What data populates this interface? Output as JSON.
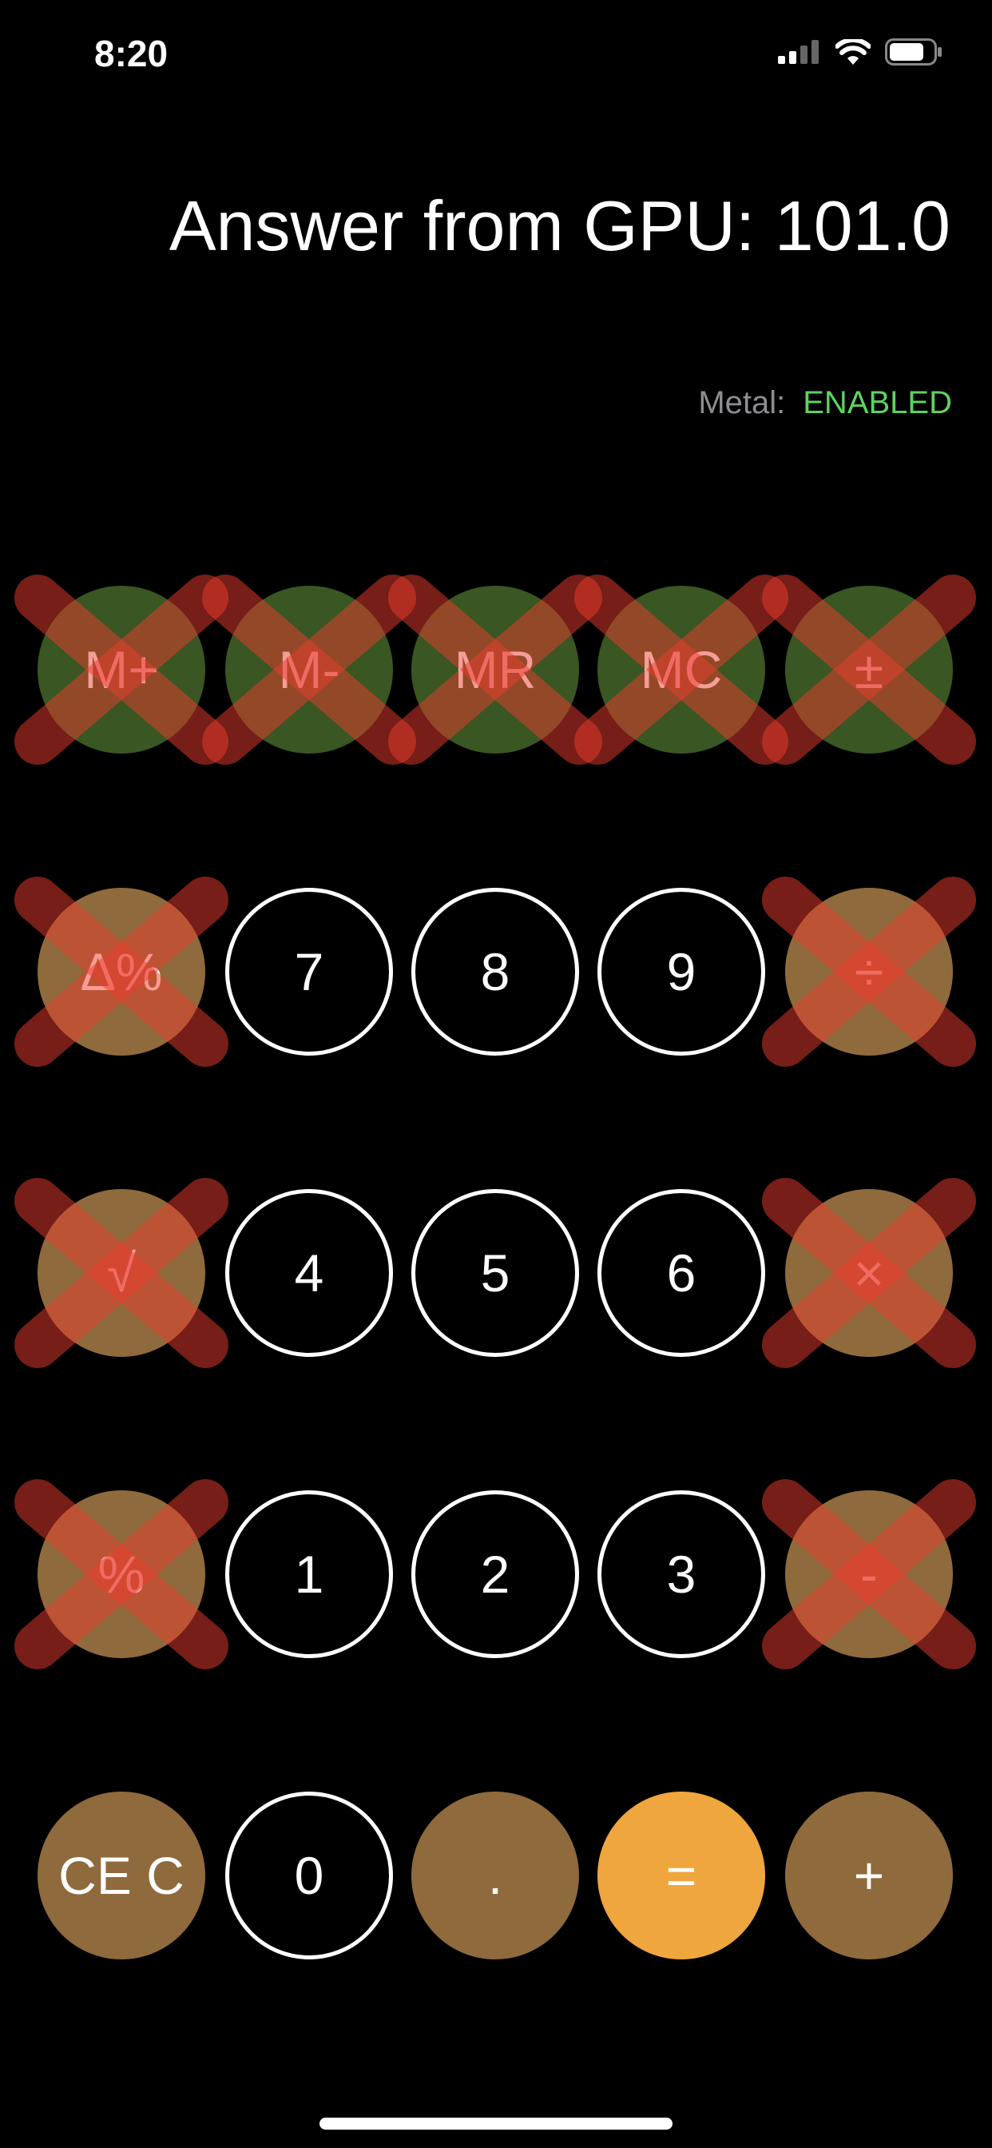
{
  "status_bar": {
    "time": "8:20",
    "icons": [
      "cellular-signal-icon",
      "wifi-icon",
      "battery-icon"
    ]
  },
  "answer_label": "Answer from GPU: 101.0",
  "metal": {
    "label": "Metal:",
    "status": "ENABLED",
    "status_color": "#5ed35e"
  },
  "colors": {
    "green": "#3a5622",
    "brown": "#8f6a3c",
    "orange": "#f0a63e",
    "cross": "rgba(235,60,45,0.5)"
  },
  "keypad": [
    [
      {
        "label": "M+",
        "style": "green",
        "crossed": true
      },
      {
        "label": "M-",
        "style": "green",
        "crossed": true
      },
      {
        "label": "MR",
        "style": "green",
        "crossed": true
      },
      {
        "label": "MC",
        "style": "green",
        "crossed": true
      },
      {
        "label": "±",
        "style": "green",
        "crossed": true
      }
    ],
    [
      {
        "label": "Δ%",
        "style": "brown",
        "crossed": true
      },
      {
        "label": "7",
        "style": "outline",
        "crossed": false
      },
      {
        "label": "8",
        "style": "outline",
        "crossed": false
      },
      {
        "label": "9",
        "style": "outline",
        "crossed": false
      },
      {
        "label": "÷",
        "style": "brown",
        "crossed": true
      }
    ],
    [
      {
        "label": "√",
        "style": "brown",
        "crossed": true
      },
      {
        "label": "4",
        "style": "outline",
        "crossed": false
      },
      {
        "label": "5",
        "style": "outline",
        "crossed": false
      },
      {
        "label": "6",
        "style": "outline",
        "crossed": false
      },
      {
        "label": "×",
        "style": "brown",
        "crossed": true
      }
    ],
    [
      {
        "label": "%",
        "style": "brown",
        "crossed": true
      },
      {
        "label": "1",
        "style": "outline",
        "crossed": false
      },
      {
        "label": "2",
        "style": "outline",
        "crossed": false
      },
      {
        "label": "3",
        "style": "outline",
        "crossed": false
      },
      {
        "label": "-",
        "style": "brown",
        "crossed": true
      }
    ],
    [
      {
        "label": "CE C",
        "style": "brown",
        "crossed": false
      },
      {
        "label": "0",
        "style": "outline",
        "crossed": false
      },
      {
        "label": ".",
        "style": "brown",
        "crossed": false
      },
      {
        "label": "=",
        "style": "orange",
        "crossed": false
      },
      {
        "label": "+",
        "style": "brown",
        "crossed": false
      }
    ]
  ]
}
